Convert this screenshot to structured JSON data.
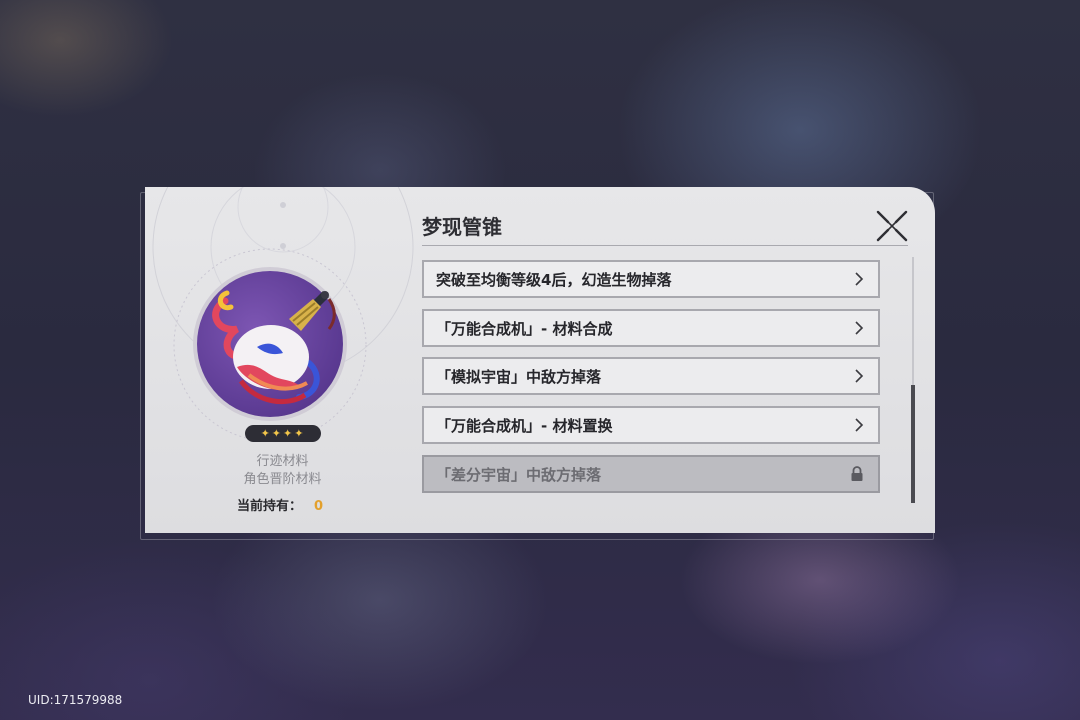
{
  "dialog": {
    "title": "梦现管锥",
    "rarity_stars": "✦✦✦✦",
    "category_line1": "行迹材料",
    "category_line2": "角色晋阶材料",
    "owned_label": "当前持有：",
    "owned_count": "0",
    "sources": [
      {
        "label": "突破至均衡等级4后，幻造生物掉落",
        "locked": false
      },
      {
        "label": "「万能合成机」- 材料合成",
        "locked": false
      },
      {
        "label": "「模拟宇宙」中敌方掉落",
        "locked": false
      },
      {
        "label": "「万能合成机」- 材料置换",
        "locked": false
      },
      {
        "label": "「差分宇宙」中敌方掉落",
        "locked": true
      }
    ],
    "icons": {
      "item": "paintbrush-icon",
      "close": "close-icon",
      "arrow": "chevron-right-icon",
      "lock": "lock-icon"
    },
    "colors": {
      "owned_count": "#e3a02c",
      "rarity_stars": "#f3c64a",
      "item_background": "#5b3a92"
    }
  },
  "footer": {
    "uid": "UID:171579988"
  }
}
